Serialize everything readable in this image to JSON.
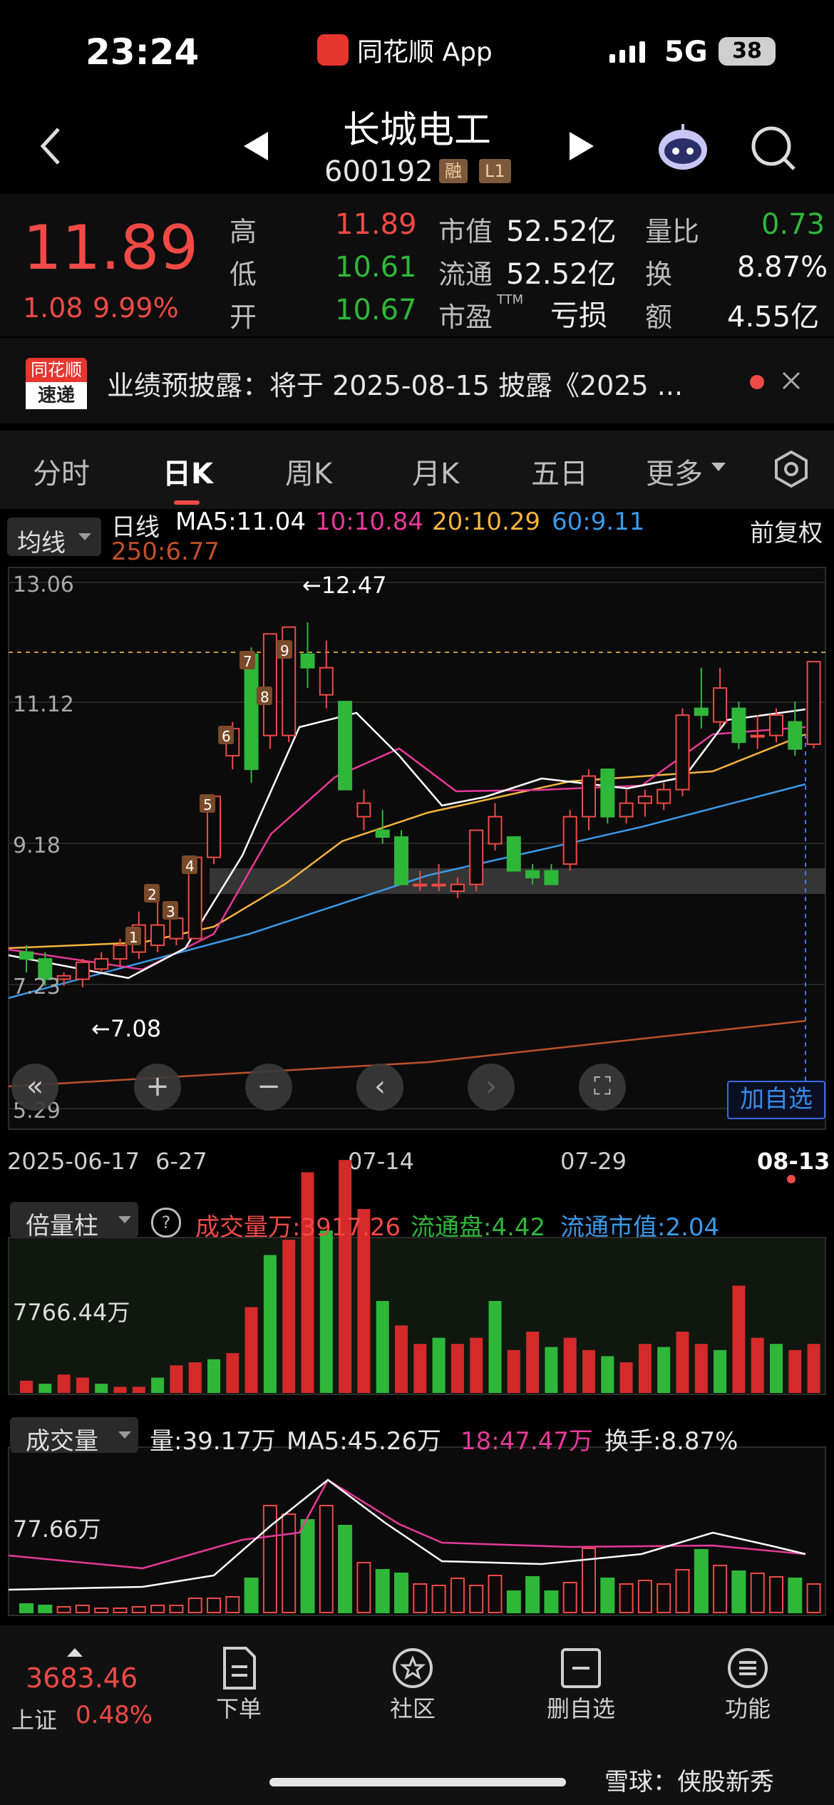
{
  "status_bar": {
    "time": "23:24",
    "app_name": "同花顺 App",
    "network": "5G",
    "battery": "38"
  },
  "header": {
    "stock_name": "长城电工",
    "stock_code": "600192",
    "tags": [
      "融",
      "L1"
    ]
  },
  "quote": {
    "price": "11.89",
    "change": "1.08",
    "change_pct": "9.99%",
    "rows": [
      {
        "label1": "高",
        "value1": "11.89",
        "label2": "市值",
        "value2": "52.52亿",
        "label3": "量比",
        "value3": "0.73"
      },
      {
        "label1": "低",
        "value1": "10.61",
        "label2": "流通",
        "value2": "52.52亿",
        "label3": "换",
        "value3": "8.87%"
      },
      {
        "label1": "开",
        "value1": "10.67",
        "label2": "市盈",
        "value2": "亏损",
        "label3": "额",
        "value3": "4.55亿"
      }
    ],
    "pe_superscript": "TTM"
  },
  "news": {
    "badge_top": "同花顺",
    "badge_bottom": "速递",
    "text": "业绩预披露：将于 2025-08-15 披露《2025 ..."
  },
  "tabs": [
    "分时",
    "日K",
    "周K",
    "月K",
    "五日",
    "更多"
  ],
  "active_tab": "日K",
  "kline": {
    "indicator_select": "均线",
    "period_label": "日线",
    "ma5": "MA5:11.04",
    "ma10": "10:10.84",
    "ma20": "20:10.29",
    "ma60": "60:9.11",
    "ma250": "250:6.77",
    "adjust": "前复权",
    "y_ticks": [
      "13.06",
      "11.12",
      "9.18",
      "7.23",
      "5.29"
    ],
    "high_marker": "←12.47",
    "low_marker": "←7.08",
    "dates": [
      "2025-06-17",
      "6-27",
      "07-14",
      "07-29",
      "08-13"
    ],
    "add_watch": "加自选",
    "nine_turn_labels": [
      "1",
      "2",
      "3",
      "4",
      "5",
      "6",
      "7",
      "8",
      "9"
    ],
    "colors": {
      "up": "#f04a46",
      "down": "#2fb73a",
      "ma5": "#ffffff",
      "ma10": "#e8399a",
      "ma20": "#f5b53a",
      "ma60": "#3a9ae8",
      "ma250": "#c0502a"
    }
  },
  "volume_ratio_panel": {
    "select": "倍量柱",
    "help": "?",
    "volume": "成交量万:3917.26",
    "float_shares": "流通盘:4.42",
    "float_value": "流通市值:2.04",
    "y_tick": "7766.44万"
  },
  "volume_panel": {
    "select": "成交量",
    "vol": "量:39.17万",
    "ma5": "MA5:45.26万",
    "ma18": "18:47.47万",
    "turnover": "换手:8.87%",
    "y_tick": "77.66万"
  },
  "bottom_nav": {
    "index_value": "3683.46",
    "index_name": "上证",
    "index_change": "0.48%",
    "items": [
      "下单",
      "社区",
      "删自选",
      "功能"
    ]
  },
  "watermark": "雪球：侠股新秀"
}
